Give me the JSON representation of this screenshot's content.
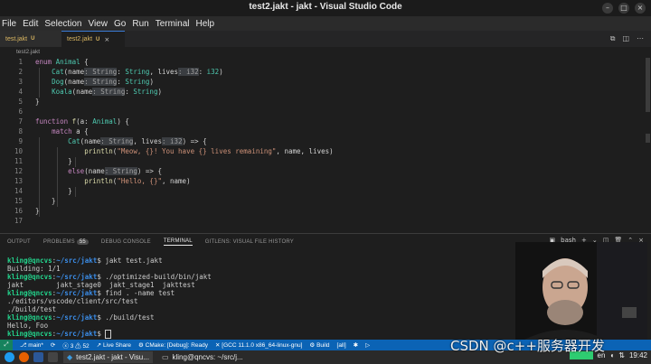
{
  "window": {
    "title": "test2.jakt - jakt - Visual Studio Code"
  },
  "menu": [
    "File",
    "Edit",
    "Selection",
    "View",
    "Go",
    "Run",
    "Terminal",
    "Help"
  ],
  "tabs": [
    {
      "label": "test.jakt",
      "modified": "U"
    },
    {
      "label": "test2.jakt",
      "modified": "U",
      "close": "×"
    }
  ],
  "breadcrumb": "test2.jakt",
  "editor": {
    "line_numbers": [
      "1",
      "2",
      "3",
      "4",
      "5",
      "6",
      "7",
      "8",
      "9",
      "10",
      "11",
      "12",
      "13",
      "14",
      "15",
      "16",
      "17"
    ],
    "lines": [
      [
        [
          "kw",
          "enum "
        ],
        [
          "ty",
          "Animal"
        ],
        [
          "pl",
          " {"
        ]
      ],
      [
        [
          "pl",
          "    "
        ],
        [
          "ty",
          "Cat"
        ],
        [
          "pl",
          "(name"
        ],
        [
          "hint",
          ": String"
        ],
        [
          "pl",
          ": "
        ],
        [
          "ty",
          "String"
        ],
        [
          "pl",
          ", lives"
        ],
        [
          "hint",
          ": i32"
        ],
        [
          "pl",
          ": "
        ],
        [
          "ty",
          "i32"
        ],
        [
          "pl",
          ")"
        ]
      ],
      [
        [
          "pl",
          "    "
        ],
        [
          "ty",
          "Dog"
        ],
        [
          "pl",
          "(name"
        ],
        [
          "hint",
          ": String"
        ],
        [
          "pl",
          ": "
        ],
        [
          "ty",
          "String"
        ],
        [
          "pl",
          ")"
        ]
      ],
      [
        [
          "pl",
          "    "
        ],
        [
          "ty",
          "Koala"
        ],
        [
          "pl",
          "(name"
        ],
        [
          "hint",
          ": String"
        ],
        [
          "pl",
          ": "
        ],
        [
          "ty",
          "String"
        ],
        [
          "pl",
          ")"
        ]
      ],
      [
        [
          "pl",
          "}"
        ]
      ],
      [
        [
          "pl",
          ""
        ]
      ],
      [
        [
          "kw",
          "function "
        ],
        [
          "fn",
          "f"
        ],
        [
          "pl",
          "(a: "
        ],
        [
          "ty",
          "Animal"
        ],
        [
          "pl",
          ") {"
        ]
      ],
      [
        [
          "pl",
          "    "
        ],
        [
          "kw",
          "match"
        ],
        [
          "pl",
          " a {"
        ]
      ],
      [
        [
          "pl",
          "        "
        ],
        [
          "ty",
          "Cat"
        ],
        [
          "pl",
          "(name"
        ],
        [
          "hint",
          ": String"
        ],
        [
          "pl",
          ", lives"
        ],
        [
          "hint",
          ": i32"
        ],
        [
          "pl",
          ") => {"
        ]
      ],
      [
        [
          "pl",
          "            "
        ],
        [
          "fn",
          "println"
        ],
        [
          "pl",
          "("
        ],
        [
          "str",
          "\"Meow, {}! You have {} lives remaining\""
        ],
        [
          "pl",
          ", name, lives)"
        ]
      ],
      [
        [
          "pl",
          "        }"
        ]
      ],
      [
        [
          "pl",
          "        "
        ],
        [
          "kw",
          "else"
        ],
        [
          "pl",
          "(name"
        ],
        [
          "hint",
          ": String"
        ],
        [
          "pl",
          ") => {"
        ]
      ],
      [
        [
          "pl",
          "            "
        ],
        [
          "fn",
          "println"
        ],
        [
          "pl",
          "("
        ],
        [
          "str",
          "\"Hello, {}\""
        ],
        [
          "pl",
          ", name)"
        ]
      ],
      [
        [
          "pl",
          "        }"
        ]
      ],
      [
        [
          "pl",
          "    }"
        ]
      ],
      [
        [
          "pl",
          "}"
        ]
      ],
      [
        [
          "pl",
          ""
        ]
      ]
    ]
  },
  "panel": {
    "tabs": [
      "OUTPUT",
      "PROBLEMS",
      "DEBUG CONSOLE",
      "TERMINAL",
      "GITLENS: VISUAL FILE HISTORY"
    ],
    "problems_count": "55",
    "shell": "bash"
  },
  "terminal": [
    {
      "prompt": "kling@qncvs",
      "path": "~/src/jakt",
      "cmd": "$ jakt test.jakt"
    },
    {
      "text": "Building: 1/1"
    },
    {
      "prompt": "kling@qncvs",
      "path": "~/src/jakt",
      "cmd": "$ ./optimized-build/bin/jakt"
    },
    {
      "text": "jakt        jakt_stage0  jakt_stage1  jakttest"
    },
    {
      "prompt": "kling@qncvs",
      "path": "~/src/jakt",
      "cmd": "$ find . -name test"
    },
    {
      "text": "./editors/vscode/client/src/test"
    },
    {
      "text": "./build/test"
    },
    {
      "prompt": "kling@qncvs",
      "path": "~/src/jakt",
      "cmd": "$ ./build/test"
    },
    {
      "text": "Hello, Foo"
    },
    {
      "prompt": "kling@qncvs",
      "path": "~/src/jakt",
      "cmd": "$ ",
      "cursor": true
    }
  ],
  "statusbar": {
    "branch": "main*",
    "errors": "3",
    "warnings": "52",
    "live_share": "Live Share",
    "cmake": "CMake: [Debug]: Ready",
    "kit": "[GCC 11.1.0 x86_64-linux-gnu]",
    "build": "Build",
    "target": "[all]"
  },
  "taskbar": {
    "tasks": [
      "test2.jakt - jakt - Visu...",
      "kling@qncvs: ~/src/j..."
    ],
    "lang": "en",
    "time": "19:42"
  },
  "watermark": "CSDN @c++服务器开发"
}
